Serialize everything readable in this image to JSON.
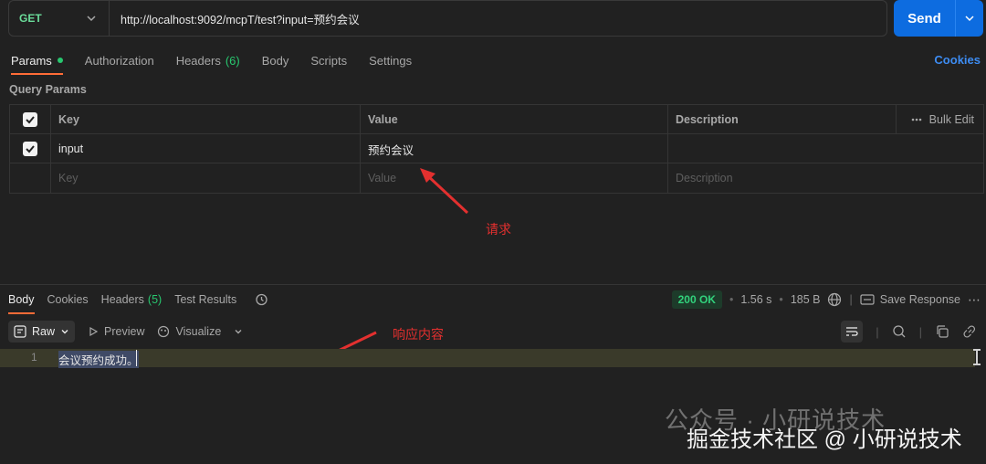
{
  "request": {
    "method": "GET",
    "url": "http://localhost:9092/mcpT/test?input=预约会议",
    "send_label": "Send"
  },
  "tabs": [
    {
      "label": "Params"
    },
    {
      "label": "Authorization"
    },
    {
      "label": "Headers",
      "count": "(6)"
    },
    {
      "label": "Body"
    },
    {
      "label": "Scripts"
    },
    {
      "label": "Settings"
    }
  ],
  "cookies_label": "Cookies",
  "query_params": {
    "title": "Query Params",
    "headers": {
      "key": "Key",
      "value": "Value",
      "description": "Description",
      "bulk_edit": "Bulk Edit"
    },
    "rows": [
      {
        "key": "input",
        "value": "预约会议",
        "description": ""
      }
    ],
    "placeholders": {
      "key": "Key",
      "value": "Value",
      "description": "Description"
    }
  },
  "annotations": {
    "request": "请求",
    "response": "响应内容"
  },
  "response": {
    "tabs": [
      {
        "label": "Body"
      },
      {
        "label": "Cookies"
      },
      {
        "label": "Headers",
        "count": "(5)"
      },
      {
        "label": "Test Results"
      }
    ],
    "status": "200 OK",
    "time": "1.56 s",
    "size": "185 B",
    "save_label": "Save Response",
    "view_mode": "Raw",
    "preview_label": "Preview",
    "visualize_label": "Visualize",
    "line_number": "1",
    "body_text": "会议预约成功。"
  },
  "watermark": {
    "line1": "公众号 · 小研说技术",
    "line2": "掘金技术社区 @ 小研说技术"
  },
  "colors": {
    "accent": "#ff6c37",
    "send": "#0d6ce0",
    "method": "#6bdd9a",
    "annotation": "#e3302f"
  }
}
